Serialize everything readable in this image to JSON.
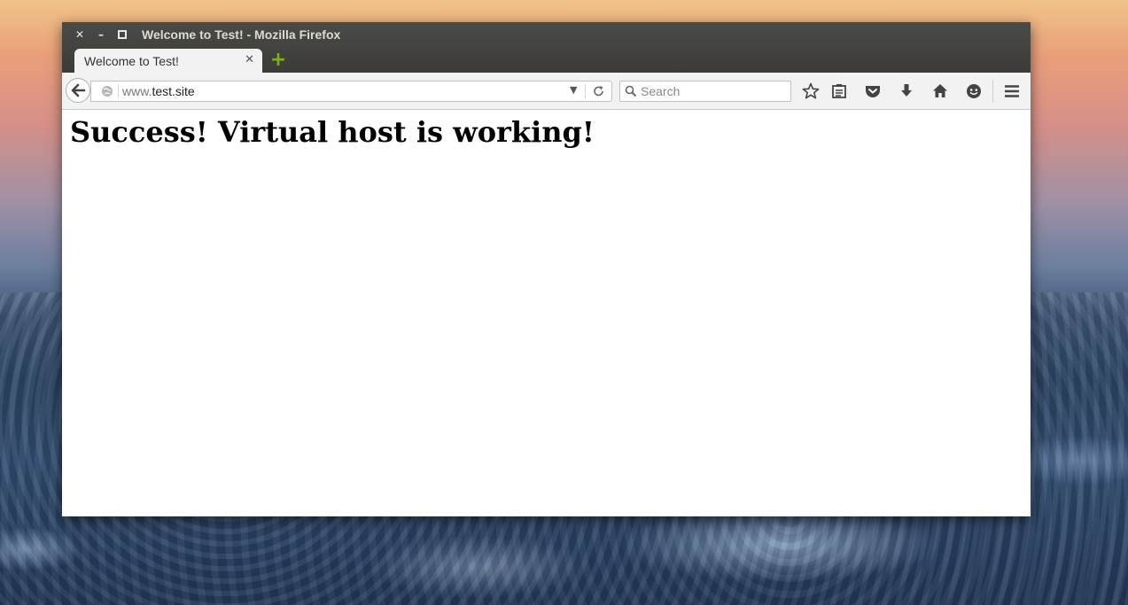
{
  "window": {
    "title": "Welcome to Test! - Mozilla Firefox"
  },
  "tabs": [
    {
      "label": "Welcome to Test!",
      "active": true
    }
  ],
  "navbar": {
    "url_prefix": "www.",
    "url_domain": "test.site",
    "search_placeholder": "Search"
  },
  "toolbar_icons": [
    "bookmark-star-icon",
    "reading-list-icon",
    "pocket-icon",
    "download-icon",
    "home-icon",
    "hello-chat-icon",
    "menu-icon"
  ],
  "page": {
    "heading": "Success! Virtual host is working!"
  },
  "colors": {
    "titlebar": "#3c3b37",
    "toolbar": "#f2f2f2",
    "newtab_accent": "#7ab317"
  }
}
